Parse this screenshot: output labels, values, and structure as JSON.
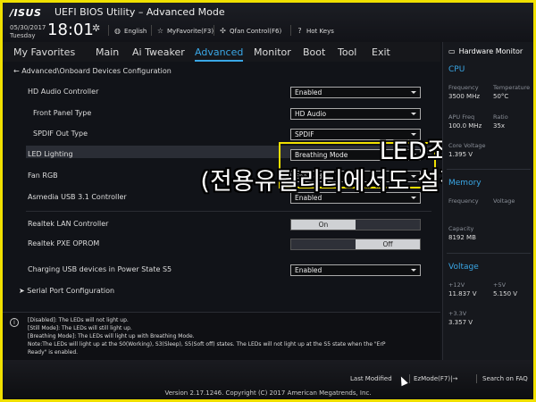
{
  "header": {
    "brand": "/ISUS",
    "title": "UEFI BIOS Utility – Advanced Mode",
    "date": "05/30/2017",
    "day": "Tuesday",
    "time": "18:01",
    "tools": [
      {
        "icon": "globe-icon",
        "label": "English"
      },
      {
        "icon": "star-icon",
        "label": "MyFavorite(F3)"
      },
      {
        "icon": "fan-icon",
        "label": "Qfan Control(F6)"
      },
      {
        "icon": "question-icon",
        "label": "Hot Keys"
      }
    ]
  },
  "menu": [
    {
      "label": "My Favorites",
      "active": false
    },
    {
      "label": "Main",
      "active": false
    },
    {
      "label": "Ai Tweaker",
      "active": false
    },
    {
      "label": "Advanced",
      "active": true
    },
    {
      "label": "Monitor",
      "active": false
    },
    {
      "label": "Boot",
      "active": false
    },
    {
      "label": "Tool",
      "active": false
    },
    {
      "label": "Exit",
      "active": false
    }
  ],
  "breadcrumb": "Advanced\\Onboard Devices Configuration",
  "settings": [
    {
      "label": "HD Audio Controller",
      "value": "Enabled",
      "type": "dropdown"
    },
    {
      "label": "Front Panel Type",
      "value": "HD Audio",
      "type": "dropdown"
    },
    {
      "label": "SPDIF Out Type",
      "value": "SPDIF",
      "type": "dropdown"
    },
    {
      "label": "LED Lighting",
      "value": "Breathing Mode",
      "type": "dropdown"
    },
    {
      "label": "Fan RGB",
      "value": "Enabled",
      "type": "dropdown"
    },
    {
      "label": "Asmedia USB 3.1 Controller",
      "value": "Enabled",
      "type": "dropdown"
    },
    {
      "label": "Realtek LAN Controller",
      "on": "On",
      "off": "",
      "type": "toggle"
    },
    {
      "label": "Realtek PXE OPROM",
      "on": "",
      "off": "Off",
      "type": "toggle"
    },
    {
      "label": "Charging USB devices in Power State S5",
      "value": "Enabled",
      "type": "dropdown"
    },
    {
      "label": "Serial Port Configuration",
      "type": "submenu"
    }
  ],
  "overlay": {
    "line1": "LED조명설정",
    "line2": "(전용유틸리티에서도 설정가능)"
  },
  "info": [
    "[Disabled]: The LEDs will not light up.",
    "[Still Mode]: The LEDs will still light up.",
    "[Breathing Mode]: The LEDs will light up with Breathing Mode.",
    "Note:The LEDs will light up at the S0(Working), S3(Sleep), S5(Soft off) states. The LEDs will not light up at the S5 state when the \"ErP",
    "Ready\" is enabled."
  ],
  "hardware_monitor": {
    "title": "Hardware Monitor",
    "cpu": {
      "heading": "CPU",
      "frequency_label": "Frequency",
      "frequency": "3500 MHz",
      "temperature_label": "Temperature",
      "temperature": "50°C",
      "apu_label": "APU Freq",
      "apu": "100.0 MHz",
      "ratio_label": "Ratio",
      "ratio": "35x",
      "core_voltage_label": "Core Voltage",
      "core_voltage": "1.395 V"
    },
    "memory": {
      "heading": "Memory",
      "frequency_label": "Frequency",
      "voltage_label": "Voltage",
      "capacity_label": "Capacity",
      "capacity": "8192 MB"
    },
    "voltage": {
      "heading": "Voltage",
      "v12_label": "+12V",
      "v12": "11.837 V",
      "v5_label": "+5V",
      "v5": "5.150 V",
      "v33_label": "+3.3V",
      "v33": "3.357 V"
    }
  },
  "footer": {
    "last_modified": "Last Modified",
    "ezmode": "EzMode(F7)|→",
    "search": "Search on FAQ",
    "version": "Version 2.17.1246. Copyright (C) 2017 American Megatrends, Inc."
  },
  "colors": {
    "accent": "#3aa7e6",
    "highlight_border": "#f0e000"
  }
}
